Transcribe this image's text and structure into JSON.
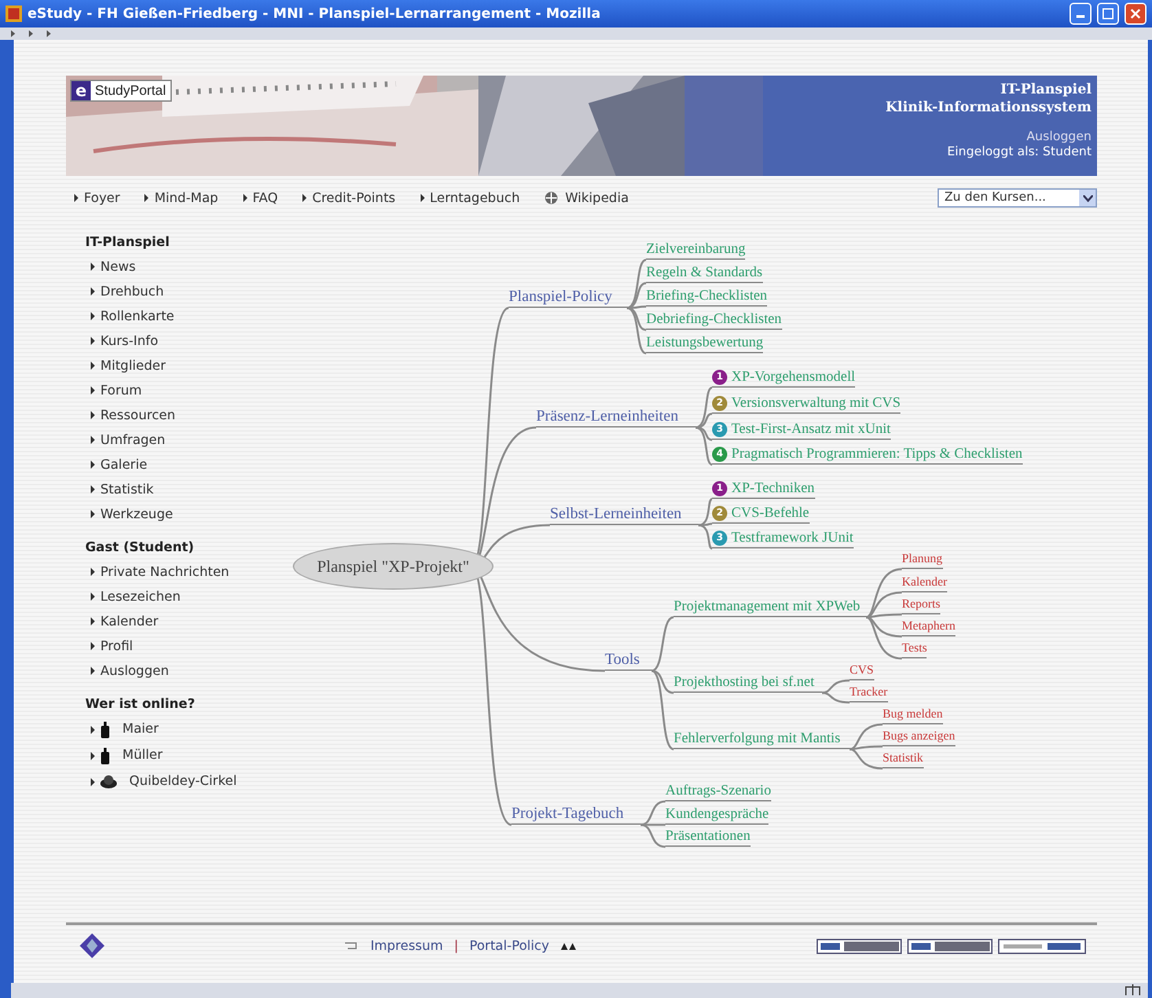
{
  "window": {
    "title": "eStudy - FH Gießen-Friedberg - MNI - Planspiel-Lernarrangement - Mozilla"
  },
  "banner": {
    "logo_mark": "e",
    "logo_text": "StudyPortal",
    "title": "IT-Planspiel",
    "subtitle": "Klinik-Informationssystem",
    "logout": "Ausloggen",
    "login_status": "Eingeloggt als: Student"
  },
  "nav": {
    "items": [
      {
        "label": "Foyer",
        "kind": "arrow"
      },
      {
        "label": "Mind-Map",
        "kind": "arrow"
      },
      {
        "label": "FAQ",
        "kind": "arrow"
      },
      {
        "label": "Credit-Points",
        "kind": "arrow"
      },
      {
        "label": "Lerntagebuch",
        "kind": "arrow"
      },
      {
        "label": "Wikipedia",
        "kind": "wiki"
      }
    ],
    "course_select": "Zu den Kursen..."
  },
  "sidebar": {
    "sections": [
      {
        "title": "IT-Planspiel",
        "items": [
          {
            "label": "News",
            "kind": "link"
          },
          {
            "label": "Drehbuch",
            "kind": "link"
          },
          {
            "label": "Rollenkarte",
            "kind": "link"
          },
          {
            "label": "Kurs-Info",
            "kind": "link"
          },
          {
            "label": "Mitglieder",
            "kind": "link"
          },
          {
            "label": "Forum",
            "kind": "link"
          },
          {
            "label": "Ressourcen",
            "kind": "link"
          },
          {
            "label": "Umfragen",
            "kind": "link"
          },
          {
            "label": "Galerie",
            "kind": "link"
          },
          {
            "label": "Statistik",
            "kind": "link"
          },
          {
            "label": "Werkzeuge",
            "kind": "link"
          }
        ]
      },
      {
        "title": "Gast (Student)",
        "items": [
          {
            "label": "Private Nachrichten",
            "kind": "link"
          },
          {
            "label": "Lesezeichen",
            "kind": "link"
          },
          {
            "label": "Kalender",
            "kind": "link"
          },
          {
            "label": "Profil",
            "kind": "link"
          },
          {
            "label": "Ausloggen",
            "kind": "link"
          }
        ]
      },
      {
        "title": "Wer ist online?",
        "items": [
          {
            "label": "Maier",
            "kind": "person"
          },
          {
            "label": "Müller",
            "kind": "person"
          },
          {
            "label": "Quibeldey-Cirkel",
            "kind": "group"
          }
        ]
      }
    ]
  },
  "mindmap": {
    "root": "Planspiel \"XP-Projekt\"",
    "branches": [
      {
        "label": "Planspiel-Policy",
        "children": [
          {
            "label": "Zielvereinbarung"
          },
          {
            "label": "Regeln & Standards"
          },
          {
            "label": "Briefing-Checklisten"
          },
          {
            "label": "Debriefing-Checklisten"
          },
          {
            "label": "Leistungsbewertung"
          }
        ]
      },
      {
        "label": "Präsenz-Lerneinheiten",
        "children": [
          {
            "label": "XP-Vorgehensmodell",
            "number": "1",
            "color": "#8a1f8a"
          },
          {
            "label": "Versionsverwaltung mit CVS",
            "number": "2",
            "color": "#a08a3a"
          },
          {
            "label": "Test-First-Ansatz  mit xUnit",
            "number": "3",
            "color": "#2a9ab0"
          },
          {
            "label": "Pragmatisch Programmieren: Tipps & Checklisten",
            "number": "4",
            "color": "#2a9a4a"
          }
        ]
      },
      {
        "label": "Selbst-Lerneinheiten",
        "children": [
          {
            "label": "XP-Techniken",
            "number": "1",
            "color": "#8a1f8a"
          },
          {
            "label": "CVS-Befehle",
            "number": "2",
            "color": "#a08a3a"
          },
          {
            "label": "Testframework JUnit",
            "number": "3",
            "color": "#2a9ab0"
          }
        ]
      },
      {
        "label": "Tools",
        "children": [
          {
            "label": "Projektmanagement mit XPWeb",
            "children": [
              {
                "label": "Planung"
              },
              {
                "label": "Kalender"
              },
              {
                "label": "Reports"
              },
              {
                "label": "Metaphern"
              },
              {
                "label": "Tests"
              }
            ]
          },
          {
            "label": "Projekthosting bei sf.net",
            "children": [
              {
                "label": "CVS"
              },
              {
                "label": "Tracker"
              }
            ]
          },
          {
            "label": "Fehlerverfolgung mit Mantis",
            "children": [
              {
                "label": "Bug melden"
              },
              {
                "label": "Bugs anzeigen"
              },
              {
                "label": "Statistik"
              }
            ]
          }
        ]
      },
      {
        "label": "Projekt-Tagebuch",
        "children": [
          {
            "label": "Auftrags-Szenario"
          },
          {
            "label": "Kundengespräche"
          },
          {
            "label": "Präsentationen"
          }
        ]
      }
    ]
  },
  "footer": {
    "links": [
      "Impressum",
      "Portal-Policy"
    ],
    "separator": "|"
  }
}
